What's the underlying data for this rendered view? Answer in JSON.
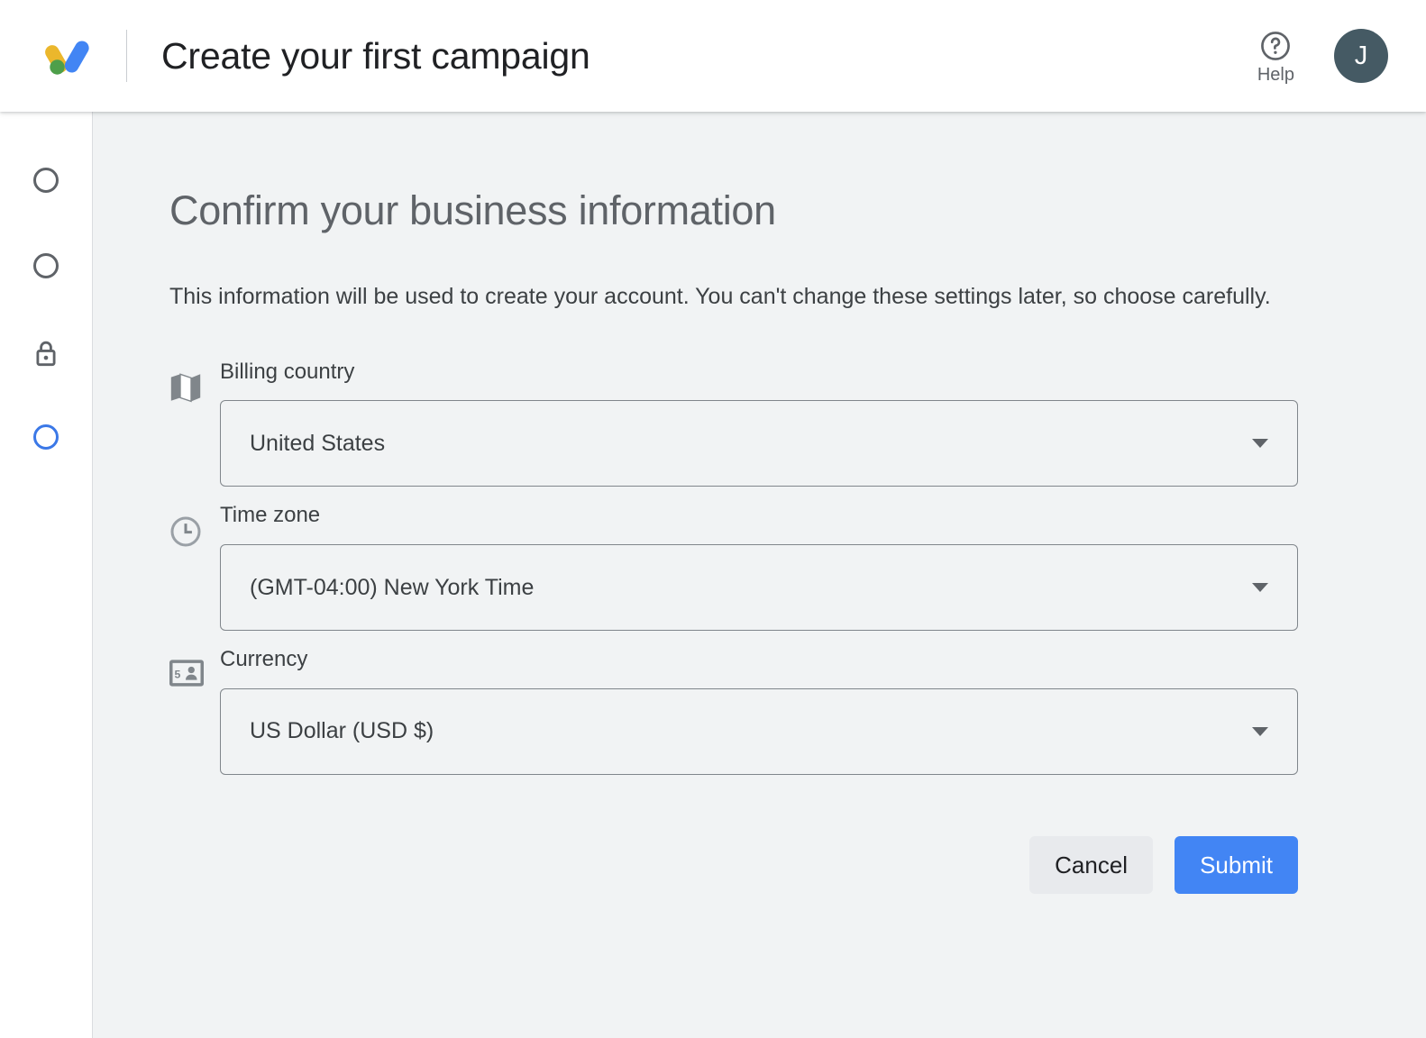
{
  "header": {
    "logo": "google-ads-logo",
    "title": "Create your first campaign",
    "help_label": "Help",
    "help_icon": "help-circle-icon",
    "avatar_initial": "J"
  },
  "stepper": {
    "steps": [
      {
        "icon": "circle-icon",
        "state": "incomplete"
      },
      {
        "icon": "circle-icon",
        "state": "incomplete"
      },
      {
        "icon": "lock-icon",
        "state": "locked"
      },
      {
        "icon": "circle-icon",
        "state": "active"
      }
    ]
  },
  "main": {
    "title": "Confirm your business information",
    "description": "This information will be used to create your account. You can't change these settings later, so choose carefully.",
    "fields": [
      {
        "icon": "map-icon",
        "label": "Billing country",
        "value": "United States",
        "caret": "chevron-down-icon"
      },
      {
        "icon": "clock-icon",
        "label": "Time zone",
        "value": "(GMT-04:00) New York Time",
        "caret": "chevron-down-icon"
      },
      {
        "icon": "money-icon",
        "label": "Currency",
        "value": "US Dollar (USD $)",
        "caret": "chevron-down-icon"
      }
    ],
    "buttons": {
      "cancel_label": "Cancel",
      "submit_label": "Submit"
    }
  },
  "colors": {
    "accent_blue": "#4285f4",
    "active_step_blue": "#3b78e7",
    "page_background": "#f1f3f4",
    "text_primary": "#3c4043",
    "text_secondary": "#5f6368",
    "avatar_background": "#455a64",
    "logo_blue": "#4285f4",
    "logo_yellow": "#ebb72c",
    "logo_green": "#4e9f4a",
    "cancel_button_background": "#e8eaed"
  }
}
